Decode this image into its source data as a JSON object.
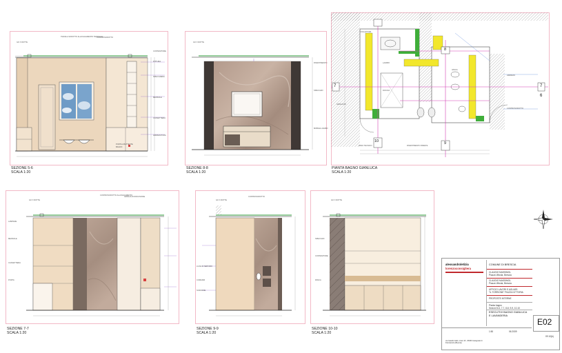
{
  "sheet": {
    "views": [
      {
        "title": "SEZIONE 5-6",
        "scale": "SCALA 1:20"
      },
      {
        "title": "SEZIONE 8-8",
        "scale": "SCALA 1:20"
      },
      {
        "title": "PIANTA BAGNO GIANLUCA",
        "scale": "SCALA 1:20"
      },
      {
        "title": "SEZIONE 7-7",
        "scale": "SCALA 1:20"
      },
      {
        "title": "SEZIONE 9-9",
        "scale": "SCALA 1:20"
      },
      {
        "title": "SEZIONE 10-10",
        "scale": "SCALA 1:20"
      }
    ],
    "plan_markers": {
      "n7": "7",
      "n8": "8",
      "n9": "9",
      "n10": "10",
      "n6": "6"
    },
    "annotations": {
      "sez56": [
        "GO X ROTTE",
        "TRAVE A SOFFITTO ALLOGGIAMENTO TENDAGGI",
        "CONTROSOFFITTO",
        "PITTURA",
        "SPECCHIERA",
        "MENSOLE",
        "CASSETTIERA",
        "ARMADIATURA",
        "CONTENITORE",
        "PORTA A BATTENTE",
        "BAGNO"
      ],
      "sez88": [
        "GO X ROTTE",
        "RIVESTIMENTO",
        "SPECCHIO",
        "MOBILE LAVABO"
      ],
      "plan": [
        "COLLETTORI",
        "LAVABO",
        "DOCCIA",
        "VASCA",
        "ARMADIO",
        "GRIGLIATO",
        "RIVESTIMENTO PARETE",
        "CONTROSOFFITTO",
        "VANO TECNICO"
      ],
      "sez77": [
        "GO X ROTTE",
        "CONTROSOFFITTO ALLOGGIAMENTO",
        "GRIGLIA DI DIFFUSIONE",
        "LAMPADE",
        "MENSOLE",
        "CASSETTIERA",
        "PORTA"
      ],
      "sez99": [
        "GO X ROTTE",
        "CONTROSOFFITTO",
        "LUCE DI SERVIZIO",
        "COMANDI",
        "SOFFIONE"
      ],
      "sez1010": [
        "GO X ROTTE",
        "SPECCHIO",
        "CONTENITORE",
        "PANCA"
      ]
    },
    "title_block": {
      "firm_line1": "alessandroletizia",
      "firm_line2": "lorenzoconsigliera",
      "client_header": "COMUNE DI BRESCIA",
      "rows": [
        "CLAUDIO MASSIMOL",
        "Piazza Vittoria, Brescia",
        "CLAUDIO MASSIMOL",
        "Piazza Vittoria, Brescia",
        "UFFICIO LAVORI E AGLIARI",
        "\"IL TORRIONE\" PIAZZA VITTORIA",
        "PROPOSTE INTERNE",
        "Pianta bagno",
        "Sezioni 5-6, 7-7, 8-8, 9-9, 10-10",
        "ESECUTIVI BAGNO GIANLUCA",
        "E LAVANDERIA"
      ],
      "bottom_left": "via Castello Gallo, civico 16 - 25030 Castegnato di Franciacorta (Brescia)",
      "scale_box": "1:50",
      "date_box": "06 2009",
      "sheet_code": "E02",
      "sheet_code_note": "09 10(b)"
    }
  }
}
